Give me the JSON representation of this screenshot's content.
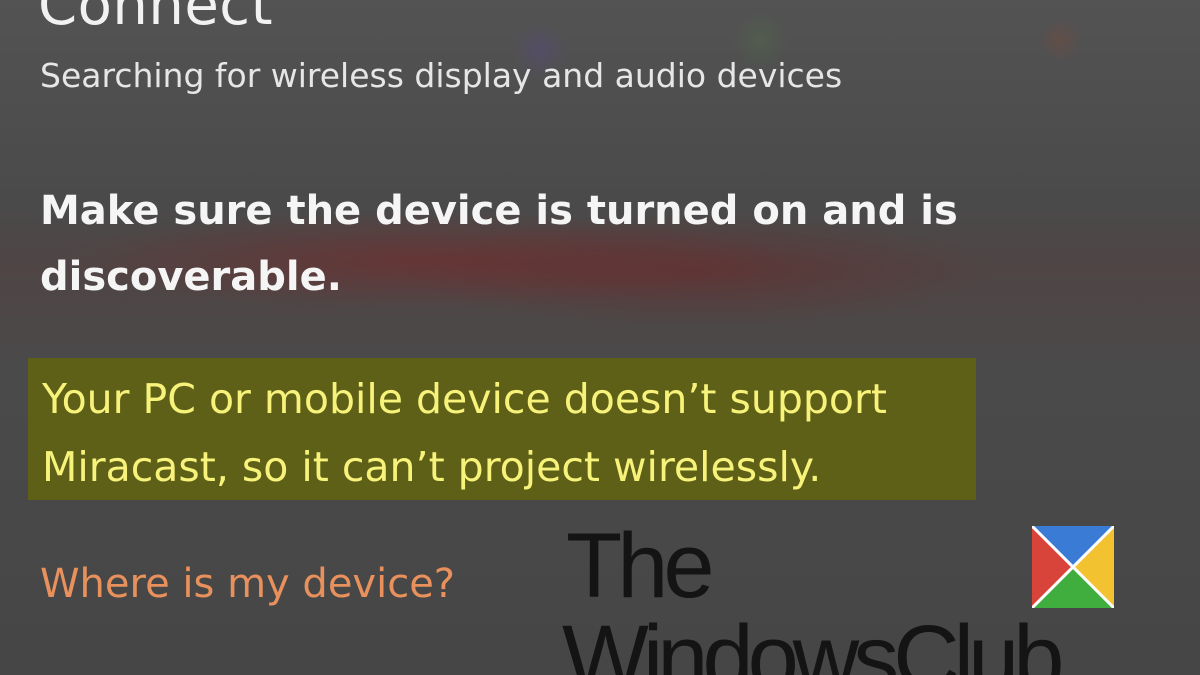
{
  "panel": {
    "title": "Connect",
    "subtitle": "Searching for wireless display and audio devices",
    "instruction": "Make sure the device is turned on and is discoverable.",
    "warning": "Your PC or mobile device doesn’t support Miracast, so it can’t project wirelessly.",
    "help_link": "Where is my device?"
  },
  "watermark": {
    "line1": "The",
    "line2": "WindowsClub",
    "logo_icon": "windowsclub-logo-icon",
    "colors": {
      "blue": "#3a7bd5",
      "yellow": "#f2c230",
      "green": "#3fae3f",
      "red": "#d9443a"
    }
  },
  "colors": {
    "background": "#4b4b4b",
    "highlight": "#5f6018",
    "warning_text": "#f6f27a",
    "link_text": "#e8915c"
  }
}
